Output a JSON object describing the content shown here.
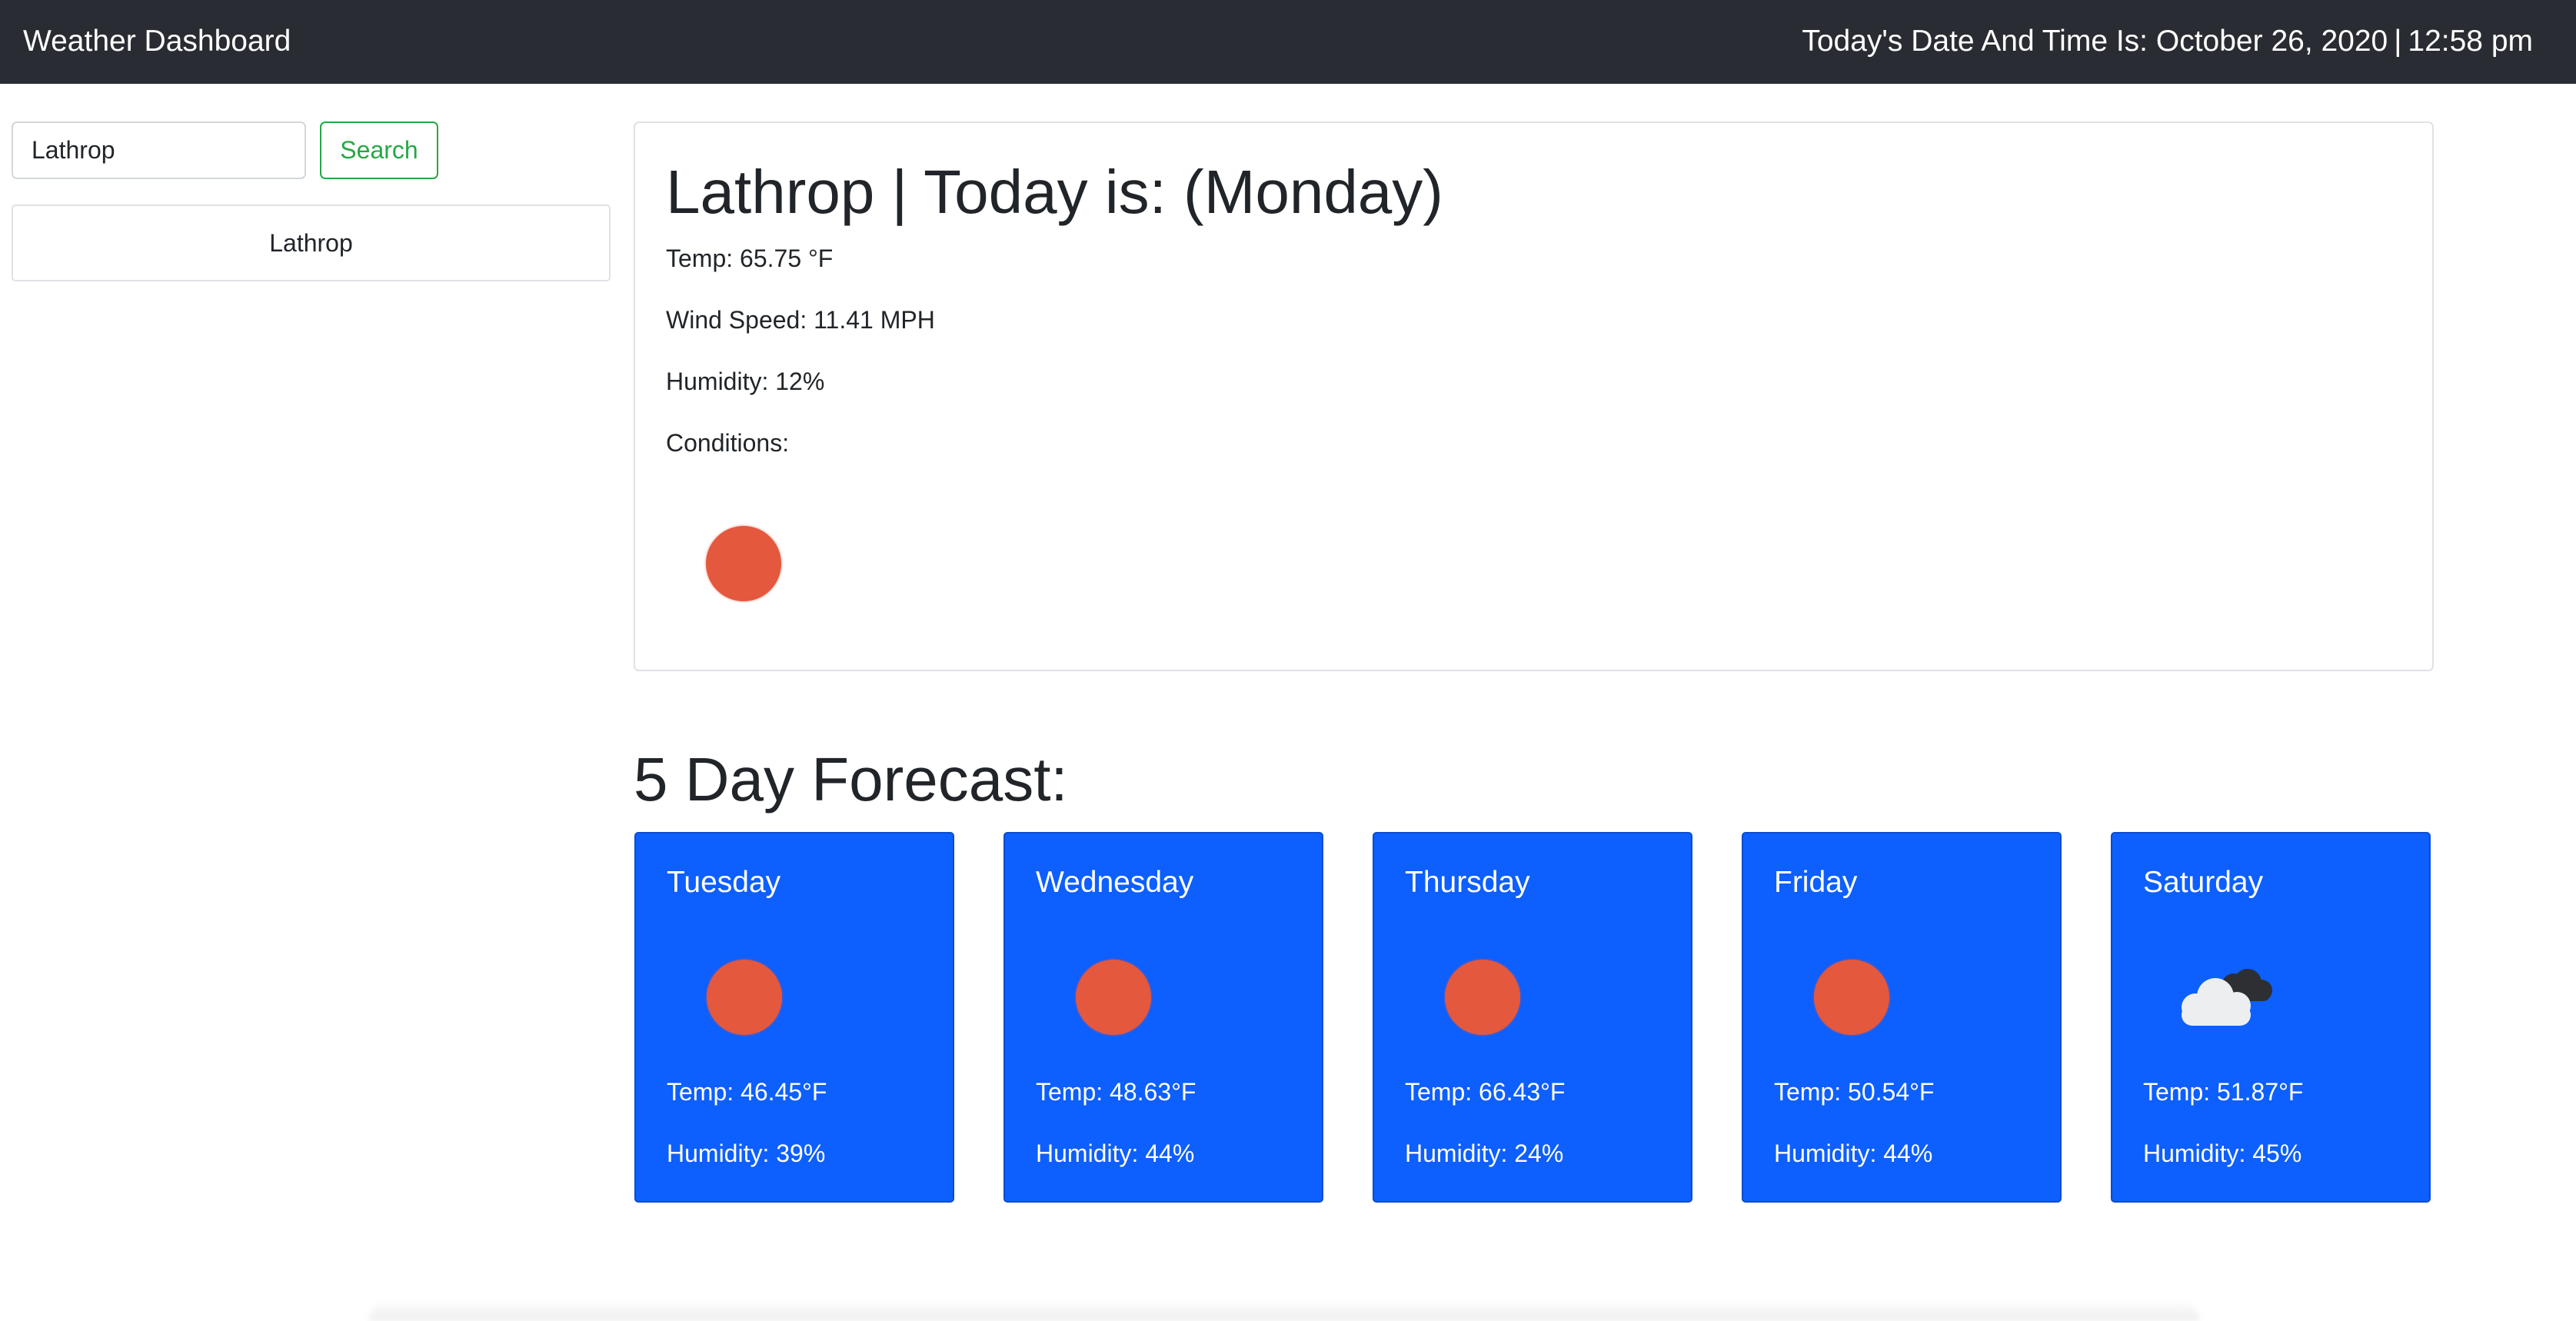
{
  "navbar": {
    "brand": "Weather Dashboard",
    "datetime_label": "Today's Date And Time Is:",
    "date": "October 26, 2020",
    "separator": "|",
    "time": "12:58 pm"
  },
  "search": {
    "value": "Lathrop",
    "button_label": "Search"
  },
  "history": [
    "Lathrop"
  ],
  "current": {
    "title": "Lathrop | Today is: (Monday)",
    "temp": "Temp: 65.75 °F",
    "wind": "Wind Speed: 11.41 MPH",
    "humidity": "Humidity: 12%",
    "conditions": "Conditions:",
    "icon": "sun-icon"
  },
  "forecast": {
    "heading": "5 Day Forecast:",
    "days": [
      {
        "day": "Tuesday",
        "icon": "sun-icon",
        "temp": "Temp: 46.45°F",
        "humidity": "Humidity: 39%"
      },
      {
        "day": "Wednesday",
        "icon": "sun-icon",
        "temp": "Temp: 48.63°F",
        "humidity": "Humidity: 44%"
      },
      {
        "day": "Thursday",
        "icon": "sun-icon",
        "temp": "Temp: 66.43°F",
        "humidity": "Humidity: 24%"
      },
      {
        "day": "Friday",
        "icon": "sun-icon",
        "temp": "Temp: 50.54°F",
        "humidity": "Humidity: 44%"
      },
      {
        "day": "Saturday",
        "icon": "cloud-icon",
        "temp": "Temp: 51.87°F",
        "humidity": "Humidity: 45%"
      }
    ]
  },
  "colors": {
    "navbar": "#292c32",
    "card_blue": "#0d5ffe",
    "sun": "#e4583e",
    "search_green": "#28a745"
  }
}
